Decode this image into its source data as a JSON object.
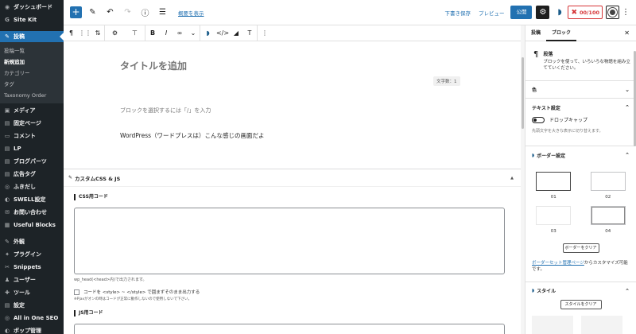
{
  "sidebar": {
    "items": [
      {
        "icon": "dashboard-icon",
        "glyph": "◉",
        "label": "ダッシュボード"
      },
      {
        "icon": "sitekit-icon",
        "glyph": "G",
        "label": "Site Kit"
      },
      {
        "icon": "pin-icon",
        "glyph": "✎",
        "label": "投稿",
        "active": true
      }
    ],
    "submenu": [
      "投稿一覧",
      "新規追加",
      "カテゴリー",
      "タグ",
      "Taxonomy Order"
    ],
    "submenu_current": 1,
    "items2": [
      {
        "icon": "media-icon",
        "glyph": "▣",
        "label": "メディア"
      },
      {
        "icon": "page-icon",
        "glyph": "▤",
        "label": "固定ページ"
      },
      {
        "icon": "comment-icon",
        "glyph": "▭",
        "label": "コメント"
      },
      {
        "icon": "lp-icon",
        "glyph": "▤",
        "label": "LP"
      },
      {
        "icon": "blog-parts-icon",
        "glyph": "▤",
        "label": "ブログパーツ"
      },
      {
        "icon": "ad-tag-icon",
        "glyph": "▤",
        "label": "広告タグ"
      },
      {
        "icon": "balloon-icon",
        "glyph": "◎",
        "label": "ふきだし"
      },
      {
        "icon": "swell-settings-icon",
        "glyph": "◐",
        "label": "SWELL設定"
      },
      {
        "icon": "contact-icon",
        "glyph": "✉",
        "label": "お問い合わせ"
      },
      {
        "icon": "useful-blocks-icon",
        "glyph": "▦",
        "label": "Useful Blocks"
      }
    ],
    "items3": [
      {
        "icon": "appearance-icon",
        "glyph": "✎",
        "label": "外観"
      },
      {
        "icon": "plugin-icon",
        "glyph": "✦",
        "label": "プラグイン"
      },
      {
        "icon": "snippets-icon",
        "glyph": "✂",
        "label": "Snippets"
      },
      {
        "icon": "users-icon",
        "glyph": "♟",
        "label": "ユーザー"
      },
      {
        "icon": "tools-icon",
        "glyph": "✚",
        "label": "ツール"
      },
      {
        "icon": "settings-icon",
        "glyph": "▤",
        "label": "設定"
      },
      {
        "icon": "aioseo-menu-icon",
        "glyph": "◎",
        "label": "All in One SEO"
      },
      {
        "icon": "blog-card-icon",
        "glyph": "◐",
        "label": "ポップ管理"
      }
    ]
  },
  "topbar": {
    "doc_overview": "概要を表示",
    "save_draft": "下書き保存",
    "preview": "プレビュー",
    "publish": "公開",
    "seo_score": "00/100"
  },
  "editor": {
    "title_placeholder": "タイトルを追加",
    "word_count": "文字数：1",
    "block_hint": "ブロックを選択するには「/」を入力",
    "paragraph": "WordPress（ワードプレスは）こんな感じの画面だよ"
  },
  "metabox": {
    "title": "カスタムCSS & JS",
    "css_label": "CSS用コード",
    "css_note": "wp_head(<head>内)で出力されます。",
    "checkbox_label": "コードを <style> ~ </style> で囲まずそのまま出力する",
    "checkbox_note": "※Pjaxがオンの時はコードが正常に動作しないので使用しないで下さい。",
    "js_label": "JS用コード"
  },
  "panel": {
    "tabs": [
      "投稿",
      "ブロック"
    ],
    "active_tab": 1,
    "block_name": "段落",
    "block_desc": "ブロックを使って、いろいろな物語を組み立てていください。",
    "color_label": "色",
    "text_settings": "テキスト設定",
    "dropcap": "ドロップキャップ",
    "dropcap_help": "先頭文字を大きな表示に切り替えます。",
    "border_settings": "ボーダー設定",
    "border_options": [
      "01",
      "02",
      "03",
      "04"
    ],
    "clear_border": "ボーダーをクリア",
    "link_text": "ボーダーセット管理ページ",
    "link_rest": "からカスタマイズ可能です。",
    "style_label": "スタイル",
    "clear_style": "スタイルをクリア"
  }
}
